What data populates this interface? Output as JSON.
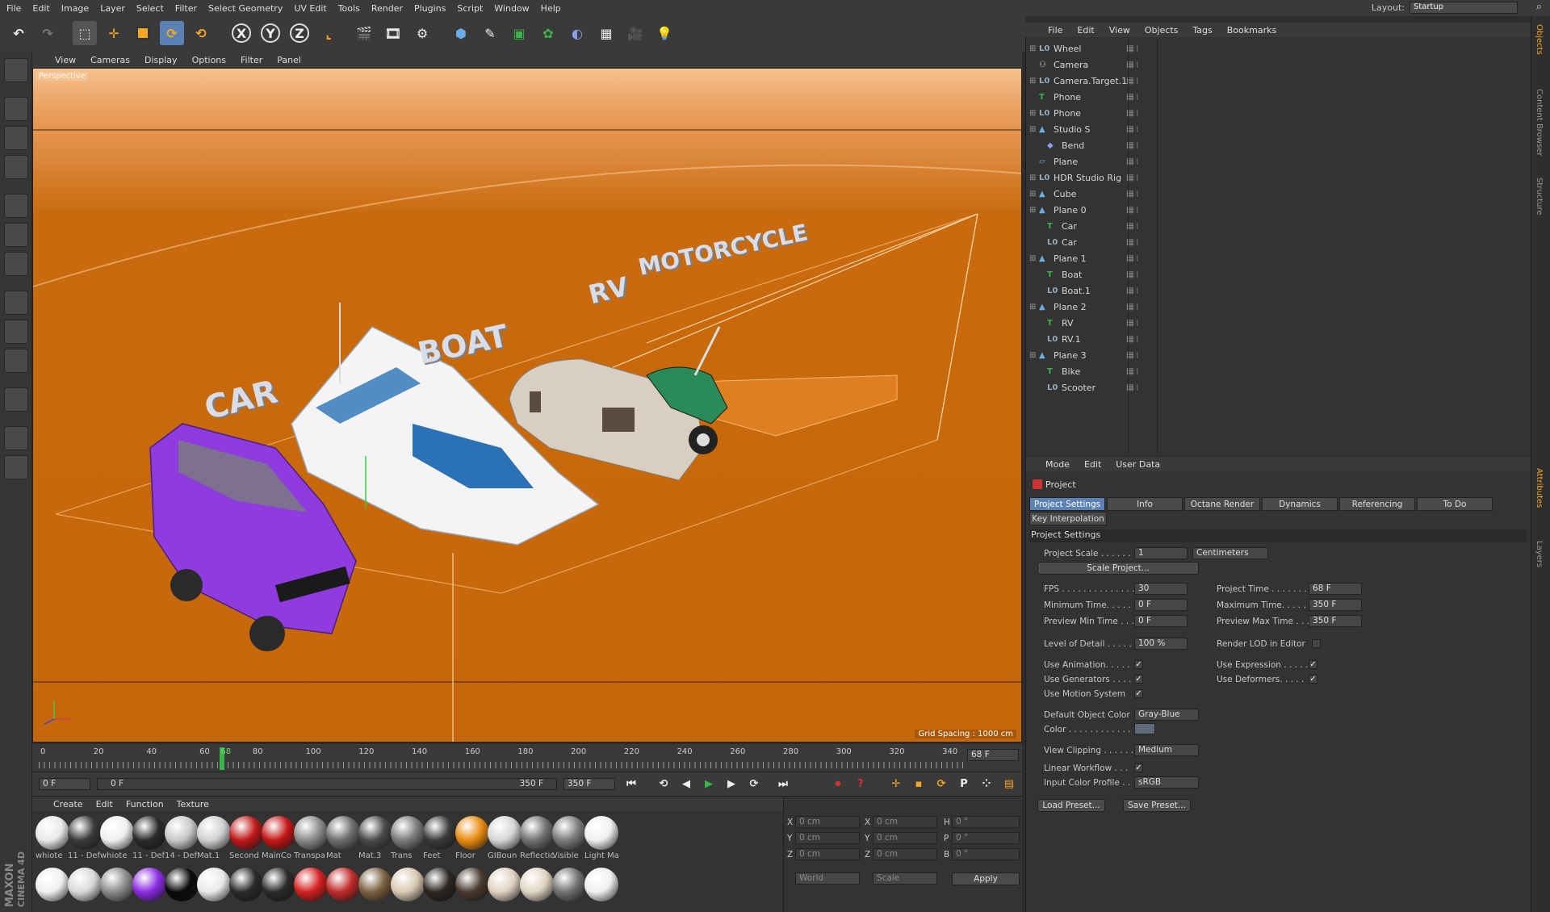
{
  "menu": [
    "File",
    "Edit",
    "Image",
    "Layer",
    "Select",
    "Filter",
    "Select Geometry",
    "UV Edit",
    "Tools",
    "Render",
    "Plugins",
    "Script",
    "Window",
    "Help"
  ],
  "layout": {
    "label": "Layout:",
    "value": "Startup"
  },
  "viewport": {
    "menu": [
      "View",
      "Cameras",
      "Display",
      "Options",
      "Filter",
      "Panel"
    ],
    "name": "Perspective",
    "grid_spacing": "Grid Spacing : 1000 cm",
    "labels": {
      "car": "CAR",
      "boat": "BOAT",
      "rv": "RV",
      "motorcycle": "MOTORCYCLE"
    }
  },
  "timeline": {
    "ticks": [
      "0",
      "20",
      "40",
      "60",
      "68",
      "80",
      "100",
      "120",
      "140",
      "160",
      "180",
      "200",
      "220",
      "240",
      "260",
      "280",
      "300",
      "320",
      "340"
    ],
    "current": "68 F",
    "start_field": "0 F",
    "slider_start": "0 F",
    "slider_end": "350 F",
    "end_field": "350 F"
  },
  "materials": {
    "menu": [
      "Create",
      "Edit",
      "Function",
      "Texture"
    ],
    "row1": [
      {
        "label": "whiote",
        "color": "#e8e8e8"
      },
      {
        "label": "11 - Def",
        "color": "#3a3a3a"
      },
      {
        "label": "whiote",
        "color": "#f0f0f0"
      },
      {
        "label": "11 - Def",
        "color": "#2a2a2a"
      },
      {
        "label": "14 - Def",
        "color": "#c8c8c8"
      },
      {
        "label": "Mat.1",
        "color": "#d0d0d0"
      },
      {
        "label": "Second",
        "color": "#c01818"
      },
      {
        "label": "MainCo",
        "color": "#c41616"
      },
      {
        "label": "Transpa",
        "color": "#8a8a8a"
      },
      {
        "label": "Mat",
        "color": "#6d6d6d"
      },
      {
        "label": "Mat.3",
        "color": "#4a4a4a"
      },
      {
        "label": "Trans",
        "color": "#7a7a7a"
      },
      {
        "label": "Feet",
        "color": "#3a3a3a"
      },
      {
        "label": "Floor",
        "color": "#e88a10"
      },
      {
        "label": "GIBoun",
        "color": "#d6d6d6"
      },
      {
        "label": "Reflectic",
        "color": "#707070"
      },
      {
        "label": "Visible",
        "color": "#7a7a7a"
      },
      {
        "label": "Light Ma",
        "color": "#f0f0f0"
      }
    ],
    "row2": [
      "#f0f0f0",
      "#d8d8d8",
      "#8a8a8a",
      "#8a2be2",
      "#0a0a0a",
      "#e8e8e8",
      "#2a2a2a",
      "#2a2a2a",
      "#d42020",
      "#c02a2a",
      "#7a6040",
      "#d8c8b0",
      "#2a2622",
      "#4a3a30",
      "#e0d0c0",
      "#e0d4c2",
      "#707070",
      "#f0f0f0"
    ]
  },
  "coords": {
    "x_pos": "0 cm",
    "y_pos": "0 cm",
    "z_pos": "0 cm",
    "x_size": "0 cm",
    "y_size": "0 cm",
    "z_size": "0 cm",
    "h": "0 °",
    "p": "0 °",
    "b": "0 °",
    "world": "World",
    "scale": "Scale",
    "apply": "Apply"
  },
  "objects": {
    "menu": [
      "File",
      "Edit",
      "View",
      "Objects",
      "Tags",
      "Bookmarks"
    ],
    "rows": [
      {
        "name": "Wheel",
        "indent": 0,
        "icon": "L0"
      },
      {
        "name": "Camera",
        "indent": 0,
        "icon": "cam"
      },
      {
        "name": "Camera.Target.1",
        "indent": 0,
        "icon": "L0"
      },
      {
        "name": "Phone",
        "indent": 0,
        "icon": "T"
      },
      {
        "name": "Phone",
        "indent": 0,
        "icon": "L0"
      },
      {
        "name": "Studio S",
        "indent": 0,
        "icon": "tri"
      },
      {
        "name": "Bend",
        "indent": 1,
        "icon": "bend"
      },
      {
        "name": "Plane",
        "indent": 0,
        "icon": "plane"
      },
      {
        "name": "HDR Studio Rig",
        "indent": 0,
        "icon": "L0"
      },
      {
        "name": "Cube",
        "indent": 0,
        "icon": "tri"
      },
      {
        "name": "Plane 0",
        "indent": 0,
        "icon": "tri"
      },
      {
        "name": "Car",
        "indent": 1,
        "icon": "T"
      },
      {
        "name": "Car",
        "indent": 1,
        "icon": "L0"
      },
      {
        "name": "Plane 1",
        "indent": 0,
        "icon": "tri"
      },
      {
        "name": "Boat",
        "indent": 1,
        "icon": "T"
      },
      {
        "name": "Boat.1",
        "indent": 1,
        "icon": "L0"
      },
      {
        "name": "Plane 2",
        "indent": 0,
        "icon": "tri"
      },
      {
        "name": "RV",
        "indent": 1,
        "icon": "T"
      },
      {
        "name": "RV.1",
        "indent": 1,
        "icon": "L0"
      },
      {
        "name": "Plane 3",
        "indent": 0,
        "icon": "tri"
      },
      {
        "name": "Bike",
        "indent": 1,
        "icon": "T"
      },
      {
        "name": "Scooter",
        "indent": 1,
        "icon": "L0"
      }
    ]
  },
  "attributes": {
    "menu": [
      "Mode",
      "Edit",
      "User Data"
    ],
    "object": "Project",
    "tabs": [
      "Project Settings",
      "Info",
      "Octane Render",
      "Dynamics",
      "Referencing",
      "To Do"
    ],
    "tab2": "Key Interpolation",
    "section": "Project Settings",
    "project_scale_label": "Project Scale . . . . . .",
    "project_scale": "1",
    "scale_unit": "Centimeters",
    "scale_project_btn": "Scale Project...",
    "fps_label": "FPS . . . . . . . . . . . . . . .",
    "fps": "30",
    "project_time_label": "Project Time . . . . . . .",
    "project_time": "68 F",
    "min_time_label": "Minimum Time. . . . .",
    "min_time": "0 F",
    "max_time_label": "Maximum Time. . . . . .",
    "max_time": "350 F",
    "prev_min_label": "Preview Min Time . . .",
    "prev_min": "0 F",
    "prev_max_label": "Preview Max Time . . .",
    "prev_max": "350 F",
    "lod_label": "Level of Detail . . . . .",
    "lod": "100 %",
    "render_lod_label": "Render LOD in Editor",
    "use_animation": "Use Animation. . . . .",
    "use_expression": "Use Expression . . . . .",
    "use_generators": "Use Generators . . . .",
    "use_deformers": "Use Deformers. . . . .",
    "use_motion": "Use Motion System",
    "default_color_label": "Default Object Color",
    "default_color": "Gray-Blue",
    "color_label": "Color . . . . . . . . . . . .",
    "view_clipping_label": "View Clipping . . . . . .",
    "view_clipping": "Medium",
    "linear_workflow": "Linear Workflow . . .",
    "input_profile_label": "Input Color Profile . .",
    "input_profile": "sRGB",
    "load_preset": "Load Preset...",
    "save_preset": "Save Preset..."
  },
  "right_tabs": [
    "Objects",
    "Content Browser",
    "Structure",
    "Attributes",
    "Layers"
  ],
  "brand": {
    "line1": "MAXON",
    "line2": "CINEMA 4D"
  }
}
